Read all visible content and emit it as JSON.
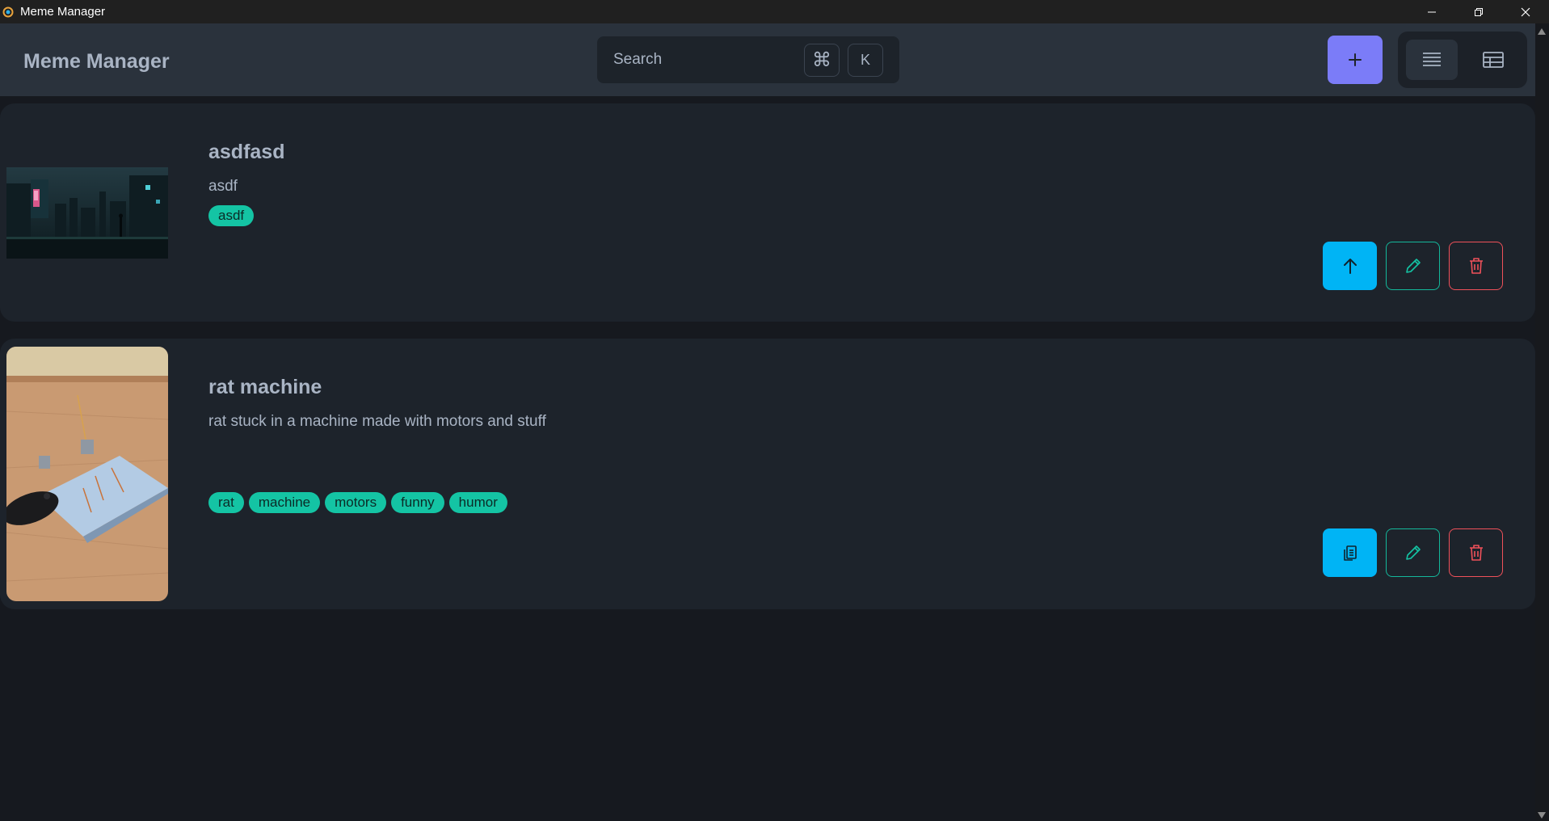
{
  "window": {
    "title": "Meme Manager",
    "icons": {
      "app": "app-logo-icon",
      "minimize": "minimize-icon",
      "restore": "restore-icon",
      "close": "close-icon"
    }
  },
  "header": {
    "brand": "Meme Manager",
    "search": {
      "placeholder": "Search",
      "shortcut_modifier": "⌘",
      "shortcut_key": "K"
    },
    "add_icon": "plus-icon",
    "view_toggle": {
      "active": "list",
      "options": [
        "list-view-icon",
        "table-view-icon"
      ]
    }
  },
  "memes": [
    {
      "title": "asdfasd",
      "description": "asdf",
      "tags": [
        "asdf"
      ],
      "thumbnail": "cyberpunk city night scene",
      "primary_action_icon": "upload-arrow-icon"
    },
    {
      "title": "rat machine",
      "description": "rat stuck in a machine made with motors and stuff",
      "tags": [
        "rat",
        "machine",
        "motors",
        "funny",
        "humor"
      ],
      "thumbnail": "rat in motor machine on wooden floor",
      "primary_action_icon": "copy-clipboard-icon"
    }
  ],
  "colors": {
    "background": "#16191f",
    "header": "#2a323c",
    "card": "#1d232b",
    "accent_primary": "#7b7cf8",
    "accent_info": "#00b4f5",
    "accent_tag": "#14c4a4",
    "accent_error": "#f0515a"
  }
}
